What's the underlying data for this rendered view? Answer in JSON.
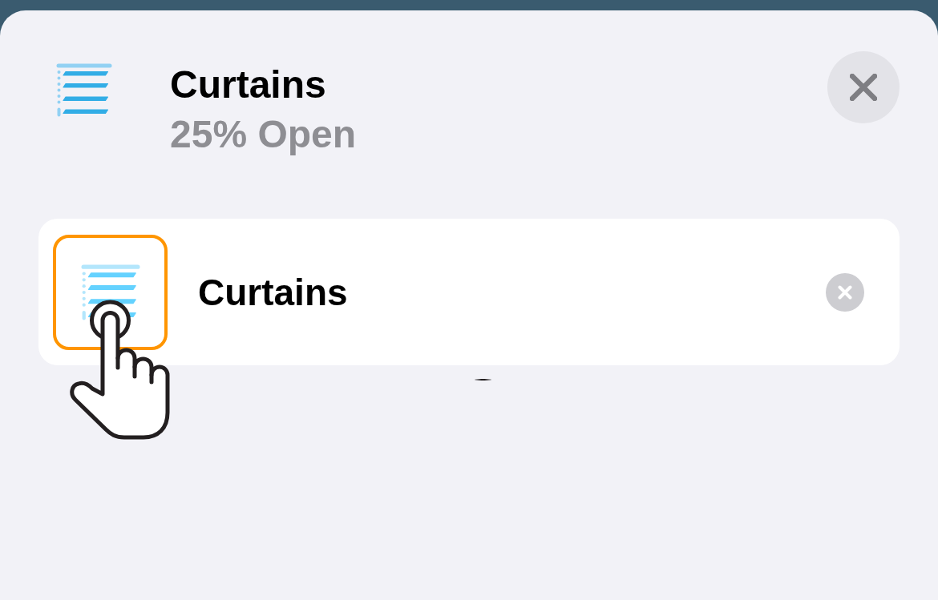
{
  "sheet": {
    "header": {
      "title": "Curtains",
      "status": "25% Open"
    },
    "accessories": [
      {
        "name": "Curtains",
        "highlighted": true
      }
    ]
  }
}
